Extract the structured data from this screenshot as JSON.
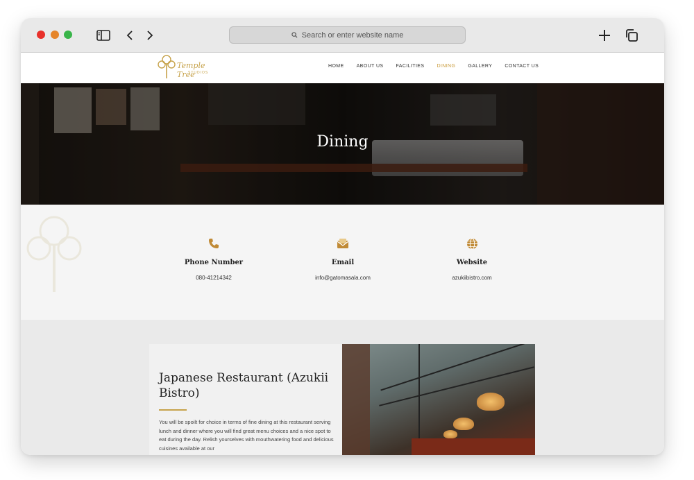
{
  "browser": {
    "url_placeholder": "Search or enter website name"
  },
  "site": {
    "logo_text": "Temple Tree",
    "logo_sub": "STUDIOS",
    "nav": [
      {
        "label": "HOME",
        "active": false
      },
      {
        "label": "ABOUT US",
        "active": false
      },
      {
        "label": "FACILITIES",
        "active": false
      },
      {
        "label": "DINING",
        "active": true
      },
      {
        "label": "GALLERY",
        "active": false
      },
      {
        "label": "CONTACT US",
        "active": false
      }
    ],
    "accent_color": "#c99a3a"
  },
  "hero": {
    "title": "Dining"
  },
  "contact": {
    "phone": {
      "icon": "phone-icon",
      "title": "Phone Number",
      "value": "080-41214342"
    },
    "email": {
      "icon": "email-icon",
      "title": "Email",
      "value": "info@gatomasala.com"
    },
    "website": {
      "icon": "globe-icon",
      "title": "Website",
      "value": "azukiibistro.com"
    }
  },
  "restaurant": {
    "title": "Japanese Restaurant (Azukii Bistro)",
    "description": "You will be spoilt for choice in terms of fine dining at this restaurant serving lunch and dinner where you will find great menu choices and a nice spot to eat during the day. Relish yourselves with mouthwatering food and delicious cuisines available at our"
  }
}
